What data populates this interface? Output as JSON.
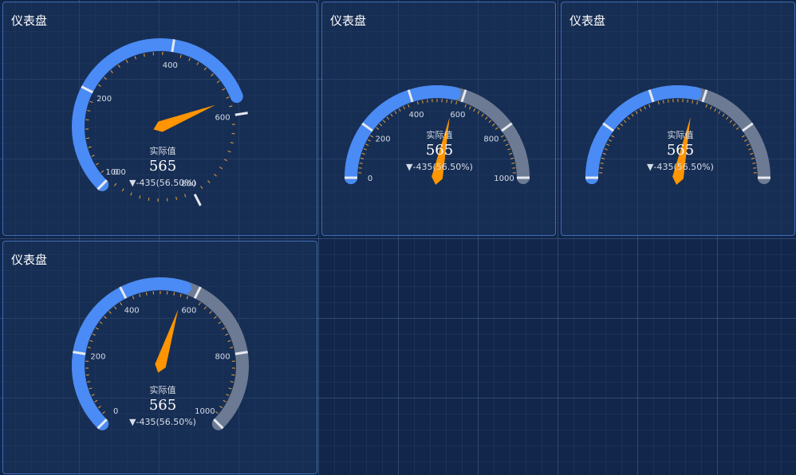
{
  "colors": {
    "background": "#11264a",
    "panel_border": "#3d6cb3",
    "progress": "#4a8bf5",
    "track": "#6c7b93",
    "pointer": "#ff9500",
    "major_tick": "#e6e9ef",
    "minor_tick": "#e8a23a"
  },
  "panels": [
    {
      "title": "仪表盘",
      "gauge": {
        "min": 0,
        "max": 1000,
        "value": 565,
        "name_label": "实际值",
        "value_text": "565",
        "delta_text": "▼-435(56.50%)",
        "start_angle": 225,
        "end_angle": -135,
        "tick_labels": [
          "0",
          "200",
          "400",
          "600",
          "800",
          "1000"
        ]
      }
    },
    {
      "title": "仪表盘",
      "gauge": {
        "min": 0,
        "max": 1000,
        "value": 565,
        "name_label": "实际值",
        "value_text": "565",
        "delta_text": "▼-435(56.50%)",
        "start_angle": 180,
        "end_angle": 0,
        "tick_labels": [
          "0",
          "200",
          "400",
          "600",
          "800",
          "1000"
        ]
      }
    },
    {
      "title": "仪表盘",
      "gauge": {
        "min": 0,
        "max": 1000,
        "value": 565,
        "name_label": "实际值",
        "value_text": "565",
        "delta_text": "▼-435(56.50%)",
        "start_angle": 180,
        "end_angle": 0,
        "tick_labels": []
      }
    },
    {
      "title": "仪表盘",
      "gauge": {
        "min": 0,
        "max": 1000,
        "value": 565,
        "name_label": "实际值",
        "value_text": "565",
        "delta_text": "▼-435(56.50%)",
        "start_angle": 225,
        "end_angle": -45,
        "tick_labels": [
          "0",
          "200",
          "400",
          "600",
          "800",
          "1000"
        ]
      }
    }
  ]
}
